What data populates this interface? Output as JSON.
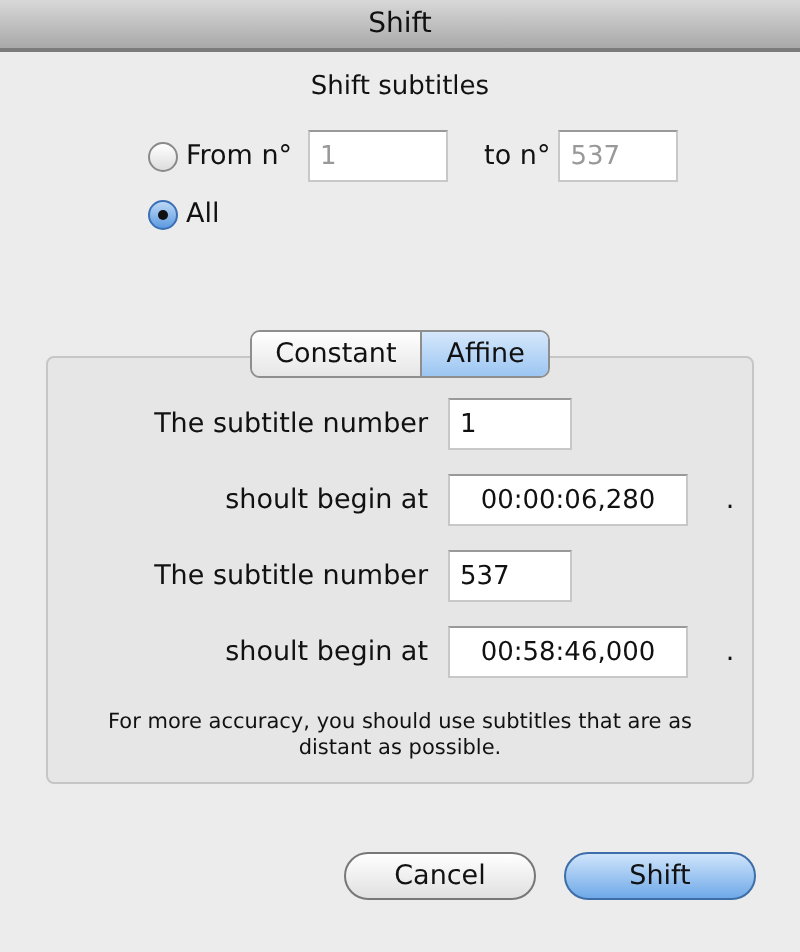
{
  "window": {
    "title": "Shift"
  },
  "heading": "Shift subtitles",
  "scope": [
    {
      "kind": "range",
      "label": "From n°",
      "selected": false,
      "from": "1",
      "to_label": "to n°",
      "to": "537",
      "disabled": true
    },
    {
      "kind": "plain",
      "label": "All",
      "selected": true
    }
  ],
  "tabs": [
    {
      "label": "Constant",
      "selected": false
    },
    {
      "label": "Affine",
      "selected": true
    }
  ],
  "points": [
    {
      "number_label": "The subtitle number",
      "number": "1",
      "time_label": "shoult begin at",
      "time": "00:00:06,280",
      "suffix": "."
    },
    {
      "number_label": "The subtitle number",
      "number": "537",
      "time_label": "shoult begin at",
      "time": "00:58:46,000",
      "suffix": "."
    }
  ],
  "note": "For more accuracy, you should use subtitles that are as distant as possible.",
  "buttons": [
    {
      "label": "Cancel",
      "default": false
    },
    {
      "label": "Shift",
      "default": true
    }
  ]
}
